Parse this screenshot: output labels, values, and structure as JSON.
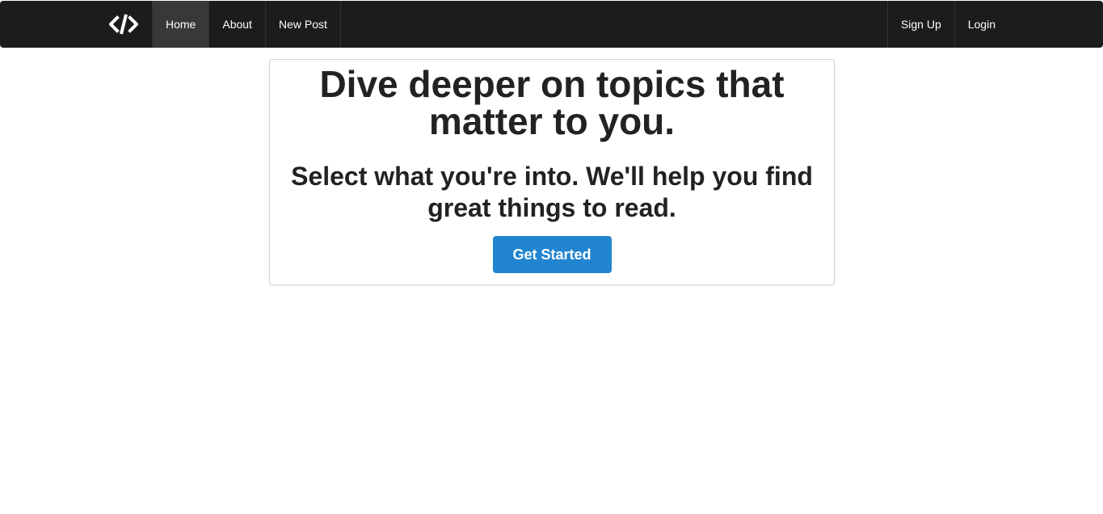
{
  "navbar": {
    "logo_icon": "code-icon",
    "items": [
      {
        "label": "Home",
        "active": true
      },
      {
        "label": "About",
        "active": false
      },
      {
        "label": "New Post",
        "active": false
      }
    ],
    "right_items": [
      {
        "label": "Sign Up"
      },
      {
        "label": "Login"
      }
    ]
  },
  "hero": {
    "headline": "Dive deeper on topics that matter to you.",
    "subheadline": "Select what you're into. We'll help you find great things to read.",
    "cta_label": "Get Started"
  },
  "colors": {
    "navbar_bg": "#1b1c1d",
    "active_item_bg": "#373839",
    "primary_button": "#2185d0"
  }
}
